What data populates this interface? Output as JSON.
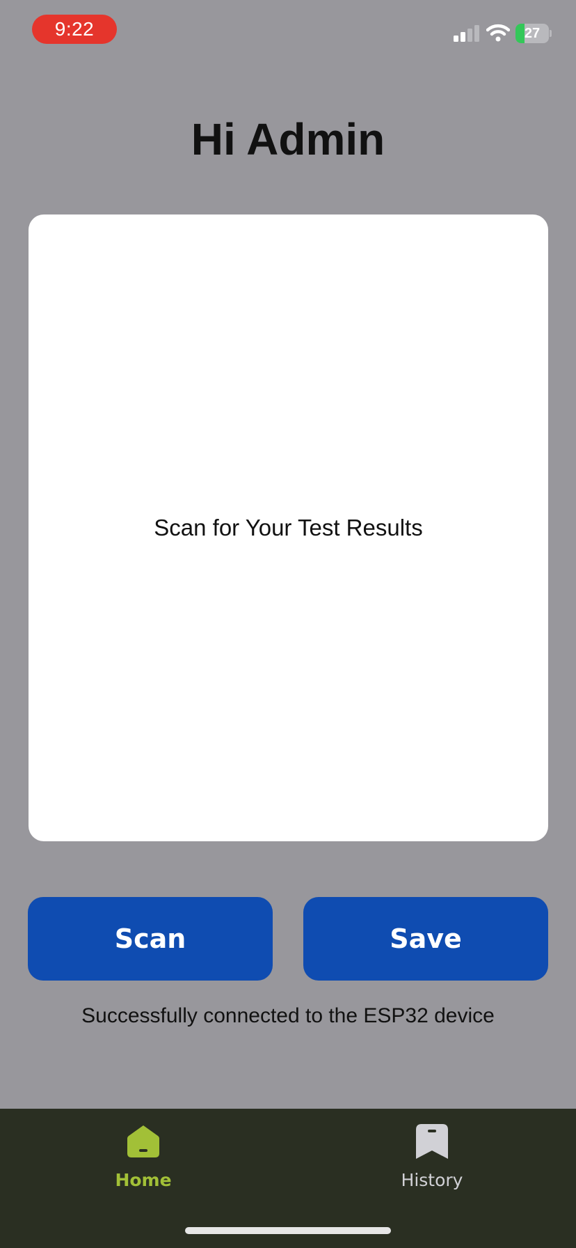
{
  "status_bar": {
    "time": "9:22",
    "battery_level": "27",
    "battery_fraction": 0.27,
    "icons": [
      "signal-icon",
      "wifi-icon",
      "battery-charging-icon"
    ]
  },
  "header": {
    "greeting": "Hi Admin"
  },
  "result_card": {
    "message": "Scan for Your Test Results"
  },
  "actions": {
    "scan_label": "Scan",
    "save_label": "Save"
  },
  "connection": {
    "status_text": "Successfully connected to the ESP32 device"
  },
  "tab_bar": {
    "items": [
      {
        "label": "Home",
        "icon": "home-icon",
        "active": true
      },
      {
        "label": "History",
        "icon": "bookmark-icon",
        "active": false
      }
    ]
  },
  "colors": {
    "background": "#98979c",
    "primary_button": "#0f4cb1",
    "tab_bar": "#2a2f22",
    "tab_active": "#a2c037",
    "tab_inactive": "#d1d1d6",
    "time_pill": "#e5352c",
    "battery_charging": "#34c759"
  }
}
